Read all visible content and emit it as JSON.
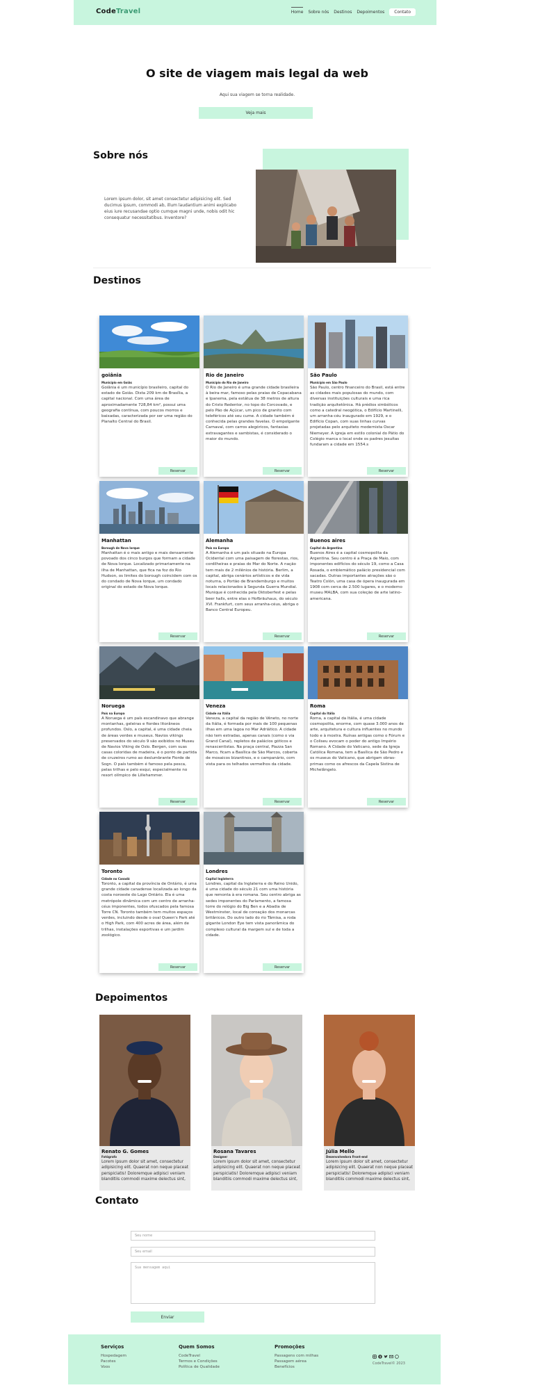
{
  "header": {
    "logo_primary": "Code",
    "logo_accent": "Travel",
    "nav": [
      "Home",
      "Sobre nós",
      "Destinos",
      "Depoimentos"
    ],
    "contact_button": "Contato"
  },
  "hero": {
    "title": "O site de viagem mais legal da web",
    "subtitle": "Aqui sua viagem se torna realidade.",
    "cta": "Veja mais"
  },
  "about": {
    "title": "Sobre nós",
    "text": "Lorem ipsum dolor, sit amet consectetur adipisicing elit. Sed ducimus ipsum, commodi ab, illum laudantium animi explicabo eius iure recusandae optio cumque magni unde, nobis odit hic consequatur necessitatibus. Inventore?"
  },
  "destinations": {
    "title": "Destinos",
    "book_label": "Reservar",
    "items": [
      {
        "name": "goiânia",
        "tag": "Município em Goiás",
        "desc": "Goiânia é um município brasileiro, capital do estado de Goiás. Dista 209 km de Brasília, a capital nacional. Com uma área de aproximadamente 728,84 km², possui uma geografia contínua, com poucos morros e baixadas, caracterizada por ser uma região do Planalto Central do Brasil.",
        "theme": "savanna"
      },
      {
        "name": "Rio de Janeiro",
        "tag": "Município do Rio de Janeiro",
        "desc": "O Rio de Janeiro é uma grande cidade brasileira à beira-mar, famoso pelas praias de Copacabana e Ipanema, pela estátua de 38 metros de altura do Cristo Redentor, no topo do Corcovado, e pelo Pão de Açúcar, um pico de granito com teleféricos até seu cume. A cidade também é conhecida pelas grandes favelas. O empolgante Carnaval, com carros alegóricos, fantasias extravagantes e sambistas, é considerado o maior do mundo.",
        "theme": "rio"
      },
      {
        "name": "São Paulo",
        "tag": "Município em São Paulo",
        "desc": "São Paulo, centro financeiro do Brasil, está entre as cidades mais populosas do mundo, com diversas instituições culturais e uma rica tradição arquitetônica. Há prédios simbólicos como a catedral neogótica, o Edifício Martinelli, um arranha-céu inaugurado em 1929, e o Edifício Copan, com suas linhas curvas projetadas pelo arquiteto modernista Oscar Niemeyer. A igreja em estilo colonial do Pátio do Colégio marca o local onde os padres jesuítas fundaram a cidade em 1554.s",
        "theme": "saopaulo"
      },
      {
        "name": "Manhattan",
        "tag": "Borough de Nova Iorque",
        "desc": "Manhattan é o mais antigo e mais densamente povoado dos cinco burgos que formam a cidade de Nova Iorque. Localizado primariamente na ilha de Manhattan, que fica na foz do Rio Hudson, os limites do borough coincidem com os do condado de Nova Iorque, um condado original do estado de Nova Iorque.",
        "theme": "manhattan"
      },
      {
        "name": "Alemanha",
        "tag": "País na Europa",
        "desc": "A Alemanha é um país situado na Europa Ocidental com uma paisagem de florestas, rios, cordilheiras e praias do Mar do Norte. A nação tem mais de 2 milênios de história. Berlim, a capital, abriga cenários artísticos e de vida noturna, o Portão de Brandemburgo e muitos locais relacionados à Segunda Guerra Mundial. Munique é conhecida pela Oktoberfest e pelas beer halls, entre elas o Hofbräuhaus, do século XVI. Frankfurt, com seus arranha-céus, abriga o Banco Central Europeu.",
        "theme": "germany"
      },
      {
        "name": "Buenos aires",
        "tag": "Capital da Argentina",
        "desc": "Buenos Aires é a capital cosmopolita da Argentina. Seu centro é a Praça de Maio, com imponentes edifícios do século 19, como a Casa Rosada, o emblemático palácio presidencial com sacadas. Outras importantes atrações são o Teatro Colón, uma casa de ópera inaugurada em 1908 com cerca de 2.500 lugares, e o moderno museu MALBA, com sua coleção de arte latino-americana.",
        "theme": "buenosaires"
      },
      {
        "name": "Noruega",
        "tag": "País na Europa",
        "desc": "A Noruega é um país escandinavo que abrange montanhas, geleiras e fiordes litorâneos profundos. Oslo, a capital, é uma cidade cheia de áreas verdes e museus. Navios vikings preservados do século 9 são exibidos no Museu de Navios Viking de Oslo. Bergen, com suas casas coloridas de madeira, é o ponto de partida de cruzeiros rumo ao deslumbrante Fiorde de Sogn. O país também é famoso pela pesca, pelas trilhas e pelo esqui, especialmente no resort olímpico de Lillehammer.",
        "theme": "norway"
      },
      {
        "name": "Veneza",
        "tag": "Cidade na Itália",
        "desc": "Veneza, a capital da região de Vêneto, no norte da Itália, é formada por mais de 100 pequenas ilhas em uma lagoa no Mar Adriático. A cidade não tem estradas, apenas canais (como o via Grand Canal), repletos de palácios góticos e renascentistas. Na praça central, Piazza San Marco, ficam a Basílica de São Marcos, coberta de mosaicos bizantinos, e o campanário, com vista para os telhados vermelhos da cidade.",
        "theme": "venice"
      },
      {
        "name": "Roma",
        "tag": "Capital da Itália",
        "desc": "Roma, a capital da Itália, é uma cidade cosmopolita, enorme, com quase 3.000 anos de arte, arquitetura e cultura influentes no mundo todo e à mostra. Ruínas antigas como o Fórum e o Coliseu evocam o poder do antigo Império Romano. A Cidade do Vaticano, sede da Igreja Católica Romana, tem a Basílica de São Pedro e os museus do Vaticano, que abrigam obras-primas como os afrescos da Capela Sistina de Michelângelo.",
        "theme": "rome"
      },
      {
        "name": "Toronto",
        "tag": "Cidade no Canadá",
        "desc": "Toronto, a capital da província de Ontário, é uma grande cidade canadense localizada ao longo da costa noroeste do Lago Ontário. Ela é uma metrópole dinâmica com um centro de arranha-céus imponentes, todos ofuscados pela famosa Torre CN. Toronto também tem muitos espaços verdes, incluindo desde o oval Queen's Park até o High Park, com 400 acres de área, além de trilhas, instalações esportivas e um jardim zoológico.",
        "theme": "toronto"
      },
      {
        "name": "Londres",
        "tag": "Capital Inglaterra",
        "desc": "Londres, capital da Inglaterra e do Reino Unido, é uma cidade do século 21 com uma história que remonta à era romana. Seu centro abriga as sedes imponentes do Parlamento, a famosa torre do relógio do Big Ben e a Abadia de Westminster, local de coroação dos monarcas britânicos. Do outro lado do rio Tâmisa, a roda gigante London Eye tem vista panorâmica do complexo cultural da margem sul e de toda a cidade.",
        "theme": "london"
      }
    ]
  },
  "testimonials": {
    "title": "Depoimentos",
    "items": [
      {
        "name": "Renato G. Gomes",
        "role": "Fotógrafo",
        "quote": "Lorem ipsum dolor sit amet, consectetur adipisicing elit. Quaerat non neque placeat perspiciatis! Doloremque adipisci veniam blanditiis commodi maxime delectus sint,",
        "skin": "#5a3a26",
        "bg": "#7a5a44",
        "shirt": "#1f2436"
      },
      {
        "name": "Rosana Tavares",
        "role": "Designer",
        "quote": "Lorem ipsum dolor sit amet, consectetur adipisicing elit. Quaerat non neque placeat perspiciatis! Doloremque adipisci veniam blanditiis commodi maxime delectus sint,",
        "skin": "#f0cdb4",
        "bg": "#c9c7c4",
        "shirt": "#d8d2c8"
      },
      {
        "name": "Júlia Mello",
        "role": "Desenvolvedora Front-end",
        "quote": "Lorem ipsum dolor sit amet, consectetur adipisicing elit. Quaerat non neque placeat perspiciatis! Doloremque adipisci veniam blanditiis commodi maxime delectus sint,",
        "skin": "#e9b79a",
        "bg": "#b0683c",
        "shirt": "#2b2b2b"
      }
    ]
  },
  "contact": {
    "title": "Contato",
    "name_placeholder": "Seu nome",
    "email_placeholder": "Seu email",
    "message_placeholder": "Sua mensagem aqui",
    "submit": "Enviar"
  },
  "footer": {
    "columns": [
      {
        "title": "Serviços",
        "links": [
          "Hospedagem",
          "Pacotes",
          "Voos"
        ]
      },
      {
        "title": "Quem Somos",
        "links": [
          "CodeTravel",
          "Termos e Condições",
          "Política de Qualidade"
        ]
      },
      {
        "title": "Promoções",
        "links": [
          "Passagens com milhas",
          "Passagem aérea",
          "Benefícios"
        ]
      }
    ],
    "social": [
      "instagram-icon",
      "facebook-icon",
      "twitter-icon",
      "email-icon",
      "whatsapp-icon"
    ],
    "copyright": "CodeTravel© 2023"
  },
  "colors": {
    "accent": "#c8f5de",
    "brand": "#3a9a73"
  }
}
